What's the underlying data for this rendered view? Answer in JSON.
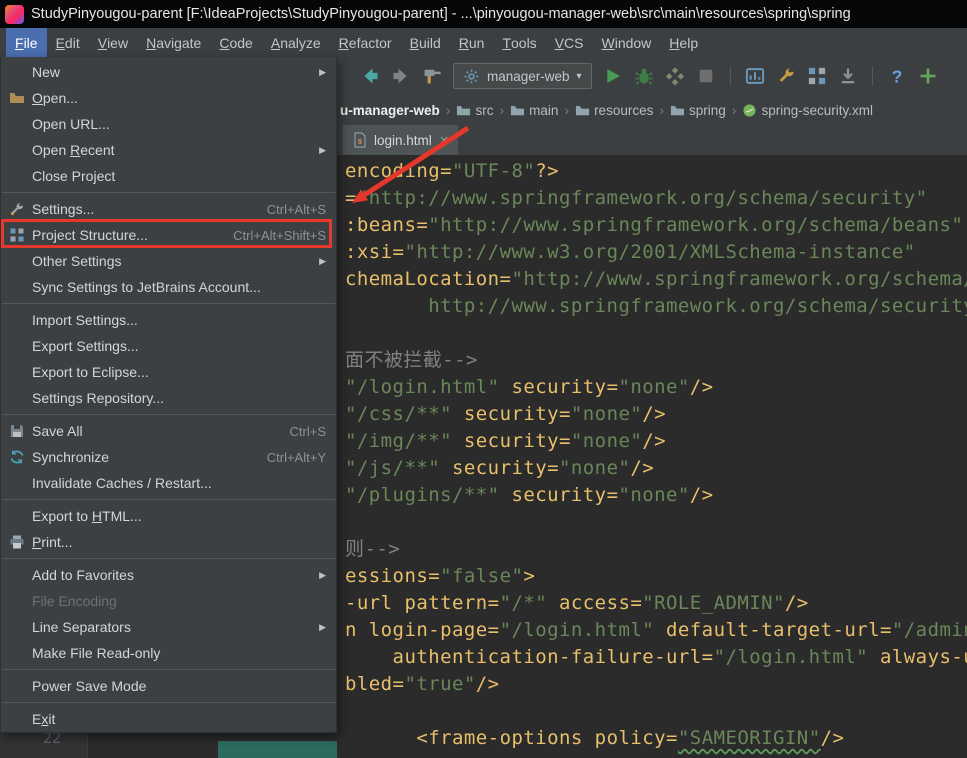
{
  "colors": {
    "editor-bg": "#2b2b2b",
    "panel-bg": "#3c3f41",
    "menu-select-blue": "#4b6eaf",
    "annotation-red": "#e5382c",
    "selection-teal": "#2d6b60",
    "run-green": "#499c54",
    "tok-tag": "#e8bf6a",
    "tok-attr": "#e8bf6a",
    "tok-string": "#6a8759",
    "tok-comment": "#808080",
    "tok-plain": "#a9b7c6"
  },
  "titlebar": {
    "title": "StudyPinyougou-parent [F:\\IdeaProjects\\StudyPinyougou-parent] - ...\\pinyougou-manager-web\\src\\main\\resources\\spring\\spring"
  },
  "menubar": {
    "items": [
      {
        "label": "File",
        "u": 0,
        "active": true
      },
      {
        "label": "Edit",
        "u": 0
      },
      {
        "label": "View",
        "u": 0
      },
      {
        "label": "Navigate",
        "u": 0
      },
      {
        "label": "Code",
        "u": 0
      },
      {
        "label": "Analyze",
        "u": 0
      },
      {
        "label": "Refactor",
        "u": 0
      },
      {
        "label": "Build",
        "u": 0
      },
      {
        "label": "Run",
        "u": 0
      },
      {
        "label": "Tools",
        "u": 0
      },
      {
        "label": "VCS",
        "u": 0
      },
      {
        "label": "Window",
        "u": 0
      },
      {
        "label": "Help",
        "u": 0
      }
    ]
  },
  "toolbar": {
    "sections": [
      {
        "icons": [
          "back",
          "forward",
          "build"
        ]
      },
      {
        "combo": {
          "icon": "gear",
          "label": "manager-web",
          "caret": "▾"
        }
      },
      {
        "icons": [
          "run",
          "debug",
          "coverage",
          "stop"
        ]
      },
      {
        "divider": true
      },
      {
        "icons": [
          "profiler",
          "settings-wrench",
          "structure",
          "download"
        ]
      },
      {
        "divider": true
      },
      {
        "icons": [
          "help",
          "add"
        ]
      }
    ]
  },
  "breadcrumbs": {
    "separator": "›",
    "items": [
      {
        "label": "u-manager-web",
        "bold": true
      },
      {
        "label": "src",
        "icon": "folder-bc"
      },
      {
        "label": "main",
        "icon": "folder-bc"
      },
      {
        "label": "resources",
        "icon": "folder-bc"
      },
      {
        "label": "spring",
        "icon": "folder-bc"
      },
      {
        "label": "spring-security.xml",
        "icon": "spring-file"
      }
    ]
  },
  "tab": {
    "label": "login.html",
    "close": "×",
    "icon": "html-file"
  },
  "file_menu": {
    "submenu_arrow": "▶",
    "items": [
      {
        "label": "New",
        "submenu": true
      },
      {
        "label": "Open...",
        "icon": "folder",
        "u": 0
      },
      {
        "label": "Open URL..."
      },
      {
        "label": "Open Recent",
        "submenu": true,
        "u": 5
      },
      {
        "label": "Close Project"
      },
      {
        "sep": true
      },
      {
        "label": "Settings...",
        "icon": "wrench",
        "shortcut": "Ctrl+Alt+S"
      },
      {
        "label": "Project Structure...",
        "icon": "structure",
        "shortcut": "Ctrl+Alt+Shift+S",
        "highlight": true
      },
      {
        "label": "Other Settings",
        "submenu": true
      },
      {
        "label": "Sync Settings to JetBrains Account..."
      },
      {
        "sep": true
      },
      {
        "label": "Import Settings..."
      },
      {
        "label": "Export Settings..."
      },
      {
        "label": "Export to Eclipse..."
      },
      {
        "label": "Settings Repository..."
      },
      {
        "sep": true
      },
      {
        "label": "Save All",
        "icon": "save",
        "shortcut": "Ctrl+S"
      },
      {
        "label": "Synchronize",
        "icon": "sync",
        "shortcut": "Ctrl+Alt+Y"
      },
      {
        "label": "Invalidate Caches / Restart..."
      },
      {
        "sep": true
      },
      {
        "label": "Export to HTML...",
        "u": 10
      },
      {
        "label": "Print...",
        "icon": "printer",
        "u": 0
      },
      {
        "sep": true
      },
      {
        "label": "Add to Favorites",
        "submenu": true
      },
      {
        "label": "File Encoding",
        "disabled": true
      },
      {
        "label": "Line Separators",
        "submenu": true
      },
      {
        "label": "Make File Read-only"
      },
      {
        "sep": true
      },
      {
        "label": "Power Save Mode"
      },
      {
        "sep": true
      },
      {
        "label": "Exit",
        "u": 1
      }
    ]
  },
  "editor": {
    "last_line": 22,
    "lines": [
      [
        [
          "attr",
          "encoding="
        ],
        [
          "str",
          "\"UTF-8\""
        ],
        [
          "tag",
          "?>"
        ]
      ],
      [
        [
          "attr",
          "="
        ],
        [
          "str",
          "\"http://www.springframework.org/schema/security\""
        ]
      ],
      [
        [
          "attr",
          ":beans="
        ],
        [
          "str",
          "\"http://www.springframework.org/schema/beans\""
        ]
      ],
      [
        [
          "attr",
          ":xsi="
        ],
        [
          "str",
          "\"http://www.w3.org/2001/XMLSchema-instance\""
        ]
      ],
      [
        [
          "attr",
          "chemaLocation="
        ],
        [
          "str",
          "\"http://www.springframework.org/schema/"
        ]
      ],
      [
        [
          "str",
          "       http://www.springframework.org/schema/security"
        ]
      ],
      [],
      [
        [
          "comment",
          "面不被拦截-->"
        ]
      ],
      [
        [
          "str",
          "\"/login.html\""
        ],
        [
          "attr",
          " security="
        ],
        [
          "str",
          "\"none\""
        ],
        [
          "tag",
          "/>"
        ]
      ],
      [
        [
          "str",
          "\"/css/**\""
        ],
        [
          "attr",
          " security="
        ],
        [
          "str",
          "\"none\""
        ],
        [
          "tag",
          "/>"
        ]
      ],
      [
        [
          "str",
          "\"/img/**\""
        ],
        [
          "attr",
          " security="
        ],
        [
          "str",
          "\"none\""
        ],
        [
          "tag",
          "/>"
        ]
      ],
      [
        [
          "str",
          "\"/js/**\""
        ],
        [
          "attr",
          " security="
        ],
        [
          "str",
          "\"none\""
        ],
        [
          "tag",
          "/>"
        ]
      ],
      [
        [
          "str",
          "\"/plugins/**\""
        ],
        [
          "attr",
          " security="
        ],
        [
          "str",
          "\"none\""
        ],
        [
          "tag",
          "/>"
        ]
      ],
      [],
      [
        [
          "comment",
          "则-->"
        ]
      ],
      [
        [
          "attr",
          "essions="
        ],
        [
          "str",
          "\"false\""
        ],
        [
          "tag",
          ">"
        ]
      ],
      [
        [
          "attr",
          "-url pattern="
        ],
        [
          "str",
          "\"/*\""
        ],
        [
          "attr",
          " access="
        ],
        [
          "str",
          "\"ROLE_ADMIN\""
        ],
        [
          "tag",
          "/>"
        ]
      ],
      [
        [
          "tag",
          "n "
        ],
        [
          "attr",
          "login-page="
        ],
        [
          "str",
          "\"/login.html\""
        ],
        [
          "attr",
          " default-target-url="
        ],
        [
          "str",
          "\"/admin"
        ]
      ],
      [
        [
          "attr",
          "    authentication-failure-url="
        ],
        [
          "str",
          "\"/login.html\""
        ],
        [
          "attr",
          " always-use"
        ]
      ],
      [
        [
          "attr",
          "bled="
        ],
        [
          "str",
          "\"true\""
        ],
        [
          "tag",
          "/>"
        ]
      ],
      [],
      [
        [
          "plain",
          "      "
        ],
        [
          "tag",
          "<frame-options"
        ],
        [
          "attr",
          " policy="
        ],
        [
          "strU",
          "\"SAMEORIGIN\""
        ],
        [
          "tag",
          "/>"
        ]
      ]
    ]
  }
}
